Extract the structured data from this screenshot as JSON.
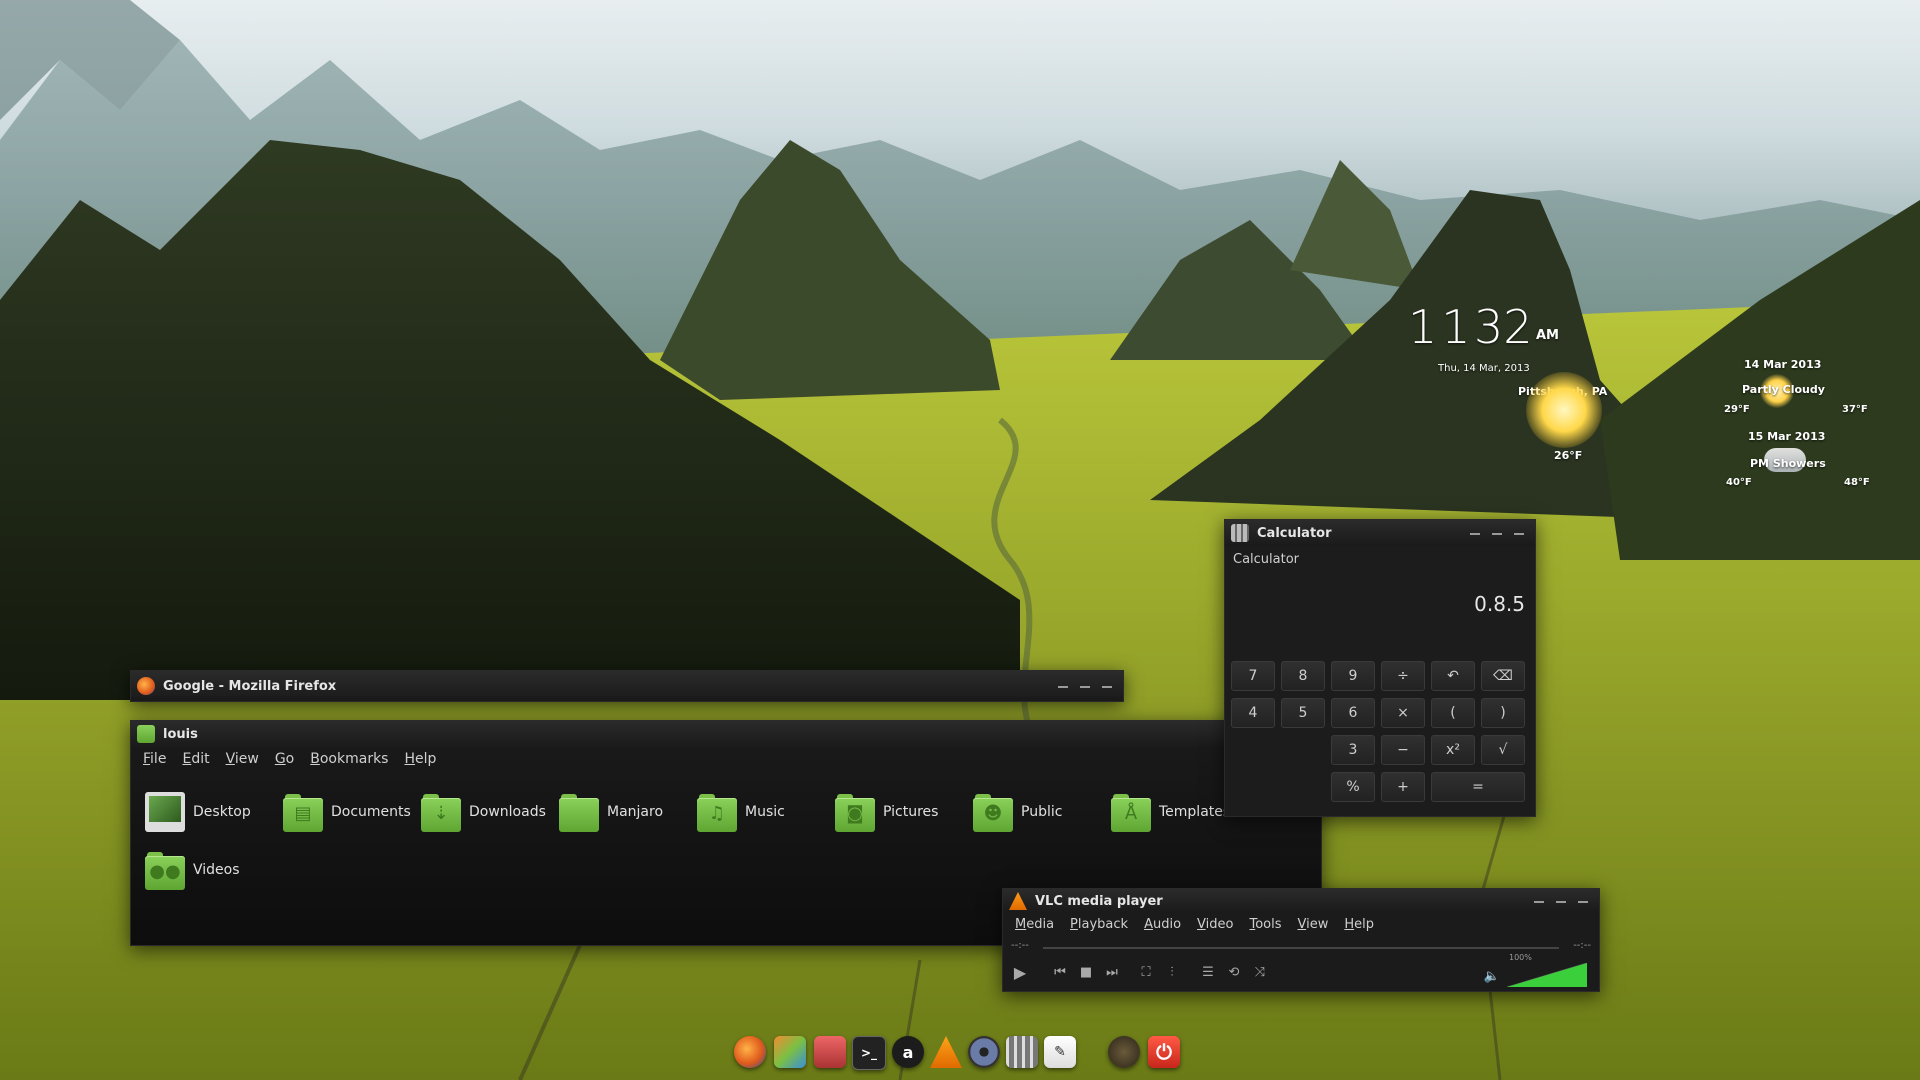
{
  "clock": {
    "hour": "11",
    "minute": "32",
    "ampm": "AM",
    "date": "Thu, 14 Mar, 2013"
  },
  "weather": {
    "location": "Pittsburgh, PA",
    "current_temp": "26°F",
    "forecast": [
      {
        "date": "14 Mar 2013",
        "condition": "Partly Cloudy",
        "low": "29°F",
        "high": "37°F"
      },
      {
        "date": "15 Mar 2013",
        "condition": "PM Showers",
        "low": "40°F",
        "high": "48°F"
      }
    ]
  },
  "firefox": {
    "title": "Google - Mozilla Firefox"
  },
  "file_manager": {
    "title": "louis",
    "menu": [
      "File",
      "Edit",
      "View",
      "Go",
      "Bookmarks",
      "Help"
    ],
    "items": [
      {
        "label": "Desktop",
        "icon": "desktop-folder-icon"
      },
      {
        "label": "Documents",
        "icon": "documents-folder-icon"
      },
      {
        "label": "Downloads",
        "icon": "downloads-folder-icon"
      },
      {
        "label": "Manjaro",
        "icon": "folder-icon"
      },
      {
        "label": "Music",
        "icon": "music-folder-icon"
      },
      {
        "label": "Pictures",
        "icon": "pictures-folder-icon"
      },
      {
        "label": "Public",
        "icon": "public-folder-icon"
      },
      {
        "label": "Templates",
        "icon": "templates-folder-icon"
      },
      {
        "label": "Videos",
        "icon": "videos-folder-icon"
      }
    ]
  },
  "calculator": {
    "title": "Calculator",
    "header": "Calculator",
    "display": "0.8.5",
    "rows": [
      [
        "7",
        "8",
        "9",
        "÷",
        "↶",
        "⌫"
      ],
      [
        "4",
        "5",
        "6",
        "×",
        "(",
        ")"
      ],
      [
        "3",
        "−",
        "x²",
        "√"
      ],
      [
        "%",
        "+",
        "="
      ]
    ]
  },
  "vlc": {
    "title": "VLC media player",
    "menu": [
      "Media",
      "Playback",
      "Audio",
      "Video",
      "Tools",
      "View",
      "Help"
    ],
    "time_elapsed": "--:--",
    "time_total": "--:--",
    "volume_label": "100%",
    "volume": 1.0
  },
  "dock": [
    "firefox-icon",
    "image-viewer-icon",
    "media-icon",
    "terminal-icon",
    "account-icon",
    "vlc-icon",
    "disc-icon",
    "mixer-icon",
    "text-editor-icon",
    "clock-icon",
    "power-icon"
  ],
  "colors": {
    "folder_green": "#7cc04a",
    "accent_red": "#d83a2a"
  }
}
